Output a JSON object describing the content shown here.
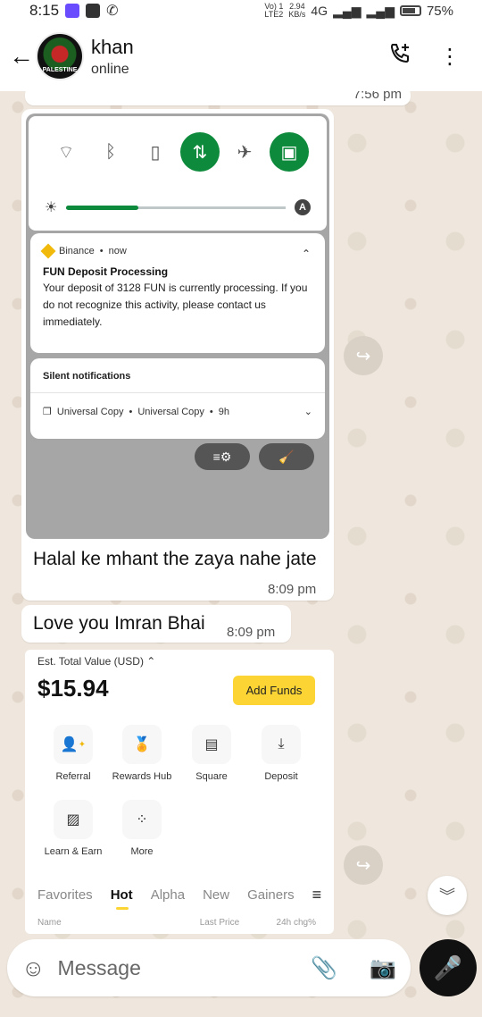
{
  "status_bar": {
    "time": "8:15",
    "network_top": "Vo) 1",
    "network_bottom": "LTE2",
    "speed_top": "2.94",
    "speed_bottom": "KB/s",
    "net_type": "4G",
    "battery": "75%"
  },
  "header": {
    "contact_name": "khan",
    "status": "online",
    "avatar_text": "PALESTINE"
  },
  "chat": {
    "partial_time": "7:56 pm",
    "image_message": {
      "notification1": {
        "app": "Binance",
        "when": "now",
        "title": "FUN Deposit Processing",
        "body": "Your deposit of 3128 FUN is currently processing. If you do not recognize this activity, please contact us immediately."
      },
      "notification2": {
        "heading": "Silent notifications",
        "app": "Universal Copy",
        "title": "Universal Copy",
        "when": "9h"
      },
      "brightness_level": 0.33
    },
    "messages": [
      {
        "text": "Halal ke mhant the zaya nahe jate",
        "time": "8:09 pm"
      },
      {
        "text": "Love you Imran Bhai",
        "time": "8:09 pm"
      }
    ],
    "card": {
      "est_label": "Est. Total Value",
      "currency": "(USD)",
      "balance": "$15.94",
      "add_funds": "Add Funds",
      "features": [
        "Referral",
        "Rewards Hub",
        "Square",
        "Deposit",
        "Learn & Earn",
        "More"
      ],
      "tabs": [
        "Favorites",
        "Hot",
        "Alpha",
        "New",
        "Gainers"
      ],
      "active_tab": "Hot",
      "columns": [
        "Name",
        "Last Price",
        "24h chg%"
      ]
    }
  },
  "composer": {
    "placeholder": "Message"
  }
}
